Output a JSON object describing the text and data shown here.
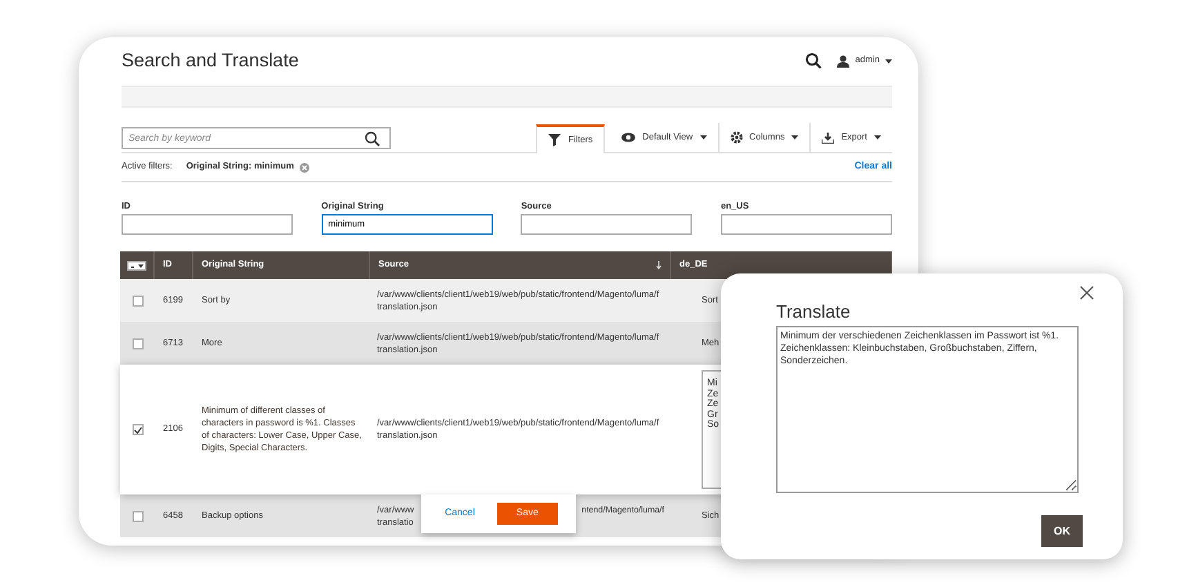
{
  "page_title": "Search and Translate",
  "header": {
    "user": "admin"
  },
  "toolbar": {
    "search_placeholder": "Search by keyword",
    "buttons": [
      {
        "label": "Filters",
        "kind": "filters",
        "selected": true
      },
      {
        "label": "Default View",
        "kind": "view",
        "selected": false
      },
      {
        "label": "Columns",
        "kind": "columns",
        "selected": false
      },
      {
        "label": "Export",
        "kind": "export",
        "selected": false
      }
    ]
  },
  "active_filters": {
    "label": "Active filters:",
    "filters": [
      "Original String: minimum"
    ],
    "clear": "Clear all"
  },
  "filter_fields": [
    {
      "label": "ID"
    },
    {
      "label": "Original String",
      "value": "minimum",
      "focused": true
    },
    {
      "label": "Source"
    },
    {
      "label": "en_US"
    }
  ],
  "table": {
    "columns": [
      "ID",
      "Original String",
      "Source",
      "de_DE"
    ],
    "rows": [
      {
        "kind": "row",
        "checked": false,
        "id": "6199",
        "original": "Sort by",
        "source": "/var/www/clients/client1/web19/web/pub/static/frontend/Magento/luma/f\ntranslation.json",
        "de_DE": "Sort"
      },
      {
        "kind": "row",
        "checked": false,
        "id": "6713",
        "original": "More",
        "source": "/var/www/clients/client1/web19/web/pub/static/frontend/Magento/luma/f\ntranslation.json",
        "de_DE": "Meh"
      },
      {
        "kind": "edit",
        "checked": true,
        "id": "2106",
        "original": "Minimum of different classes of characters in password is %1. Classes of characters: Lower Case, Upper Case, Digits, Special Characters.",
        "source": "/var/www/clients/client1/web19/web/pub/static/frontend/Magento/luma/f\ntranslation.json",
        "de_DE": "Mi\nZe\nZe\nGr\nSo"
      },
      {
        "kind": "covered",
        "checked": false,
        "id": "6458",
        "original": "Backup options",
        "source_parts": [
          "/var/www\ntranslatio",
          "ntend/Magento/luma/f"
        ],
        "de_DE": "Sich"
      }
    ]
  },
  "row_actions": {
    "cancel": "Cancel",
    "save": "Save"
  },
  "dialog": {
    "title": "Translate",
    "text": "Minimum der verschiedenen Zeichenklassen im Passwort ist %1. Zeichenklassen: Kleinbuchstaben, Großbuchstaben, Ziffern, Sonderzeichen.",
    "ok": "OK"
  }
}
